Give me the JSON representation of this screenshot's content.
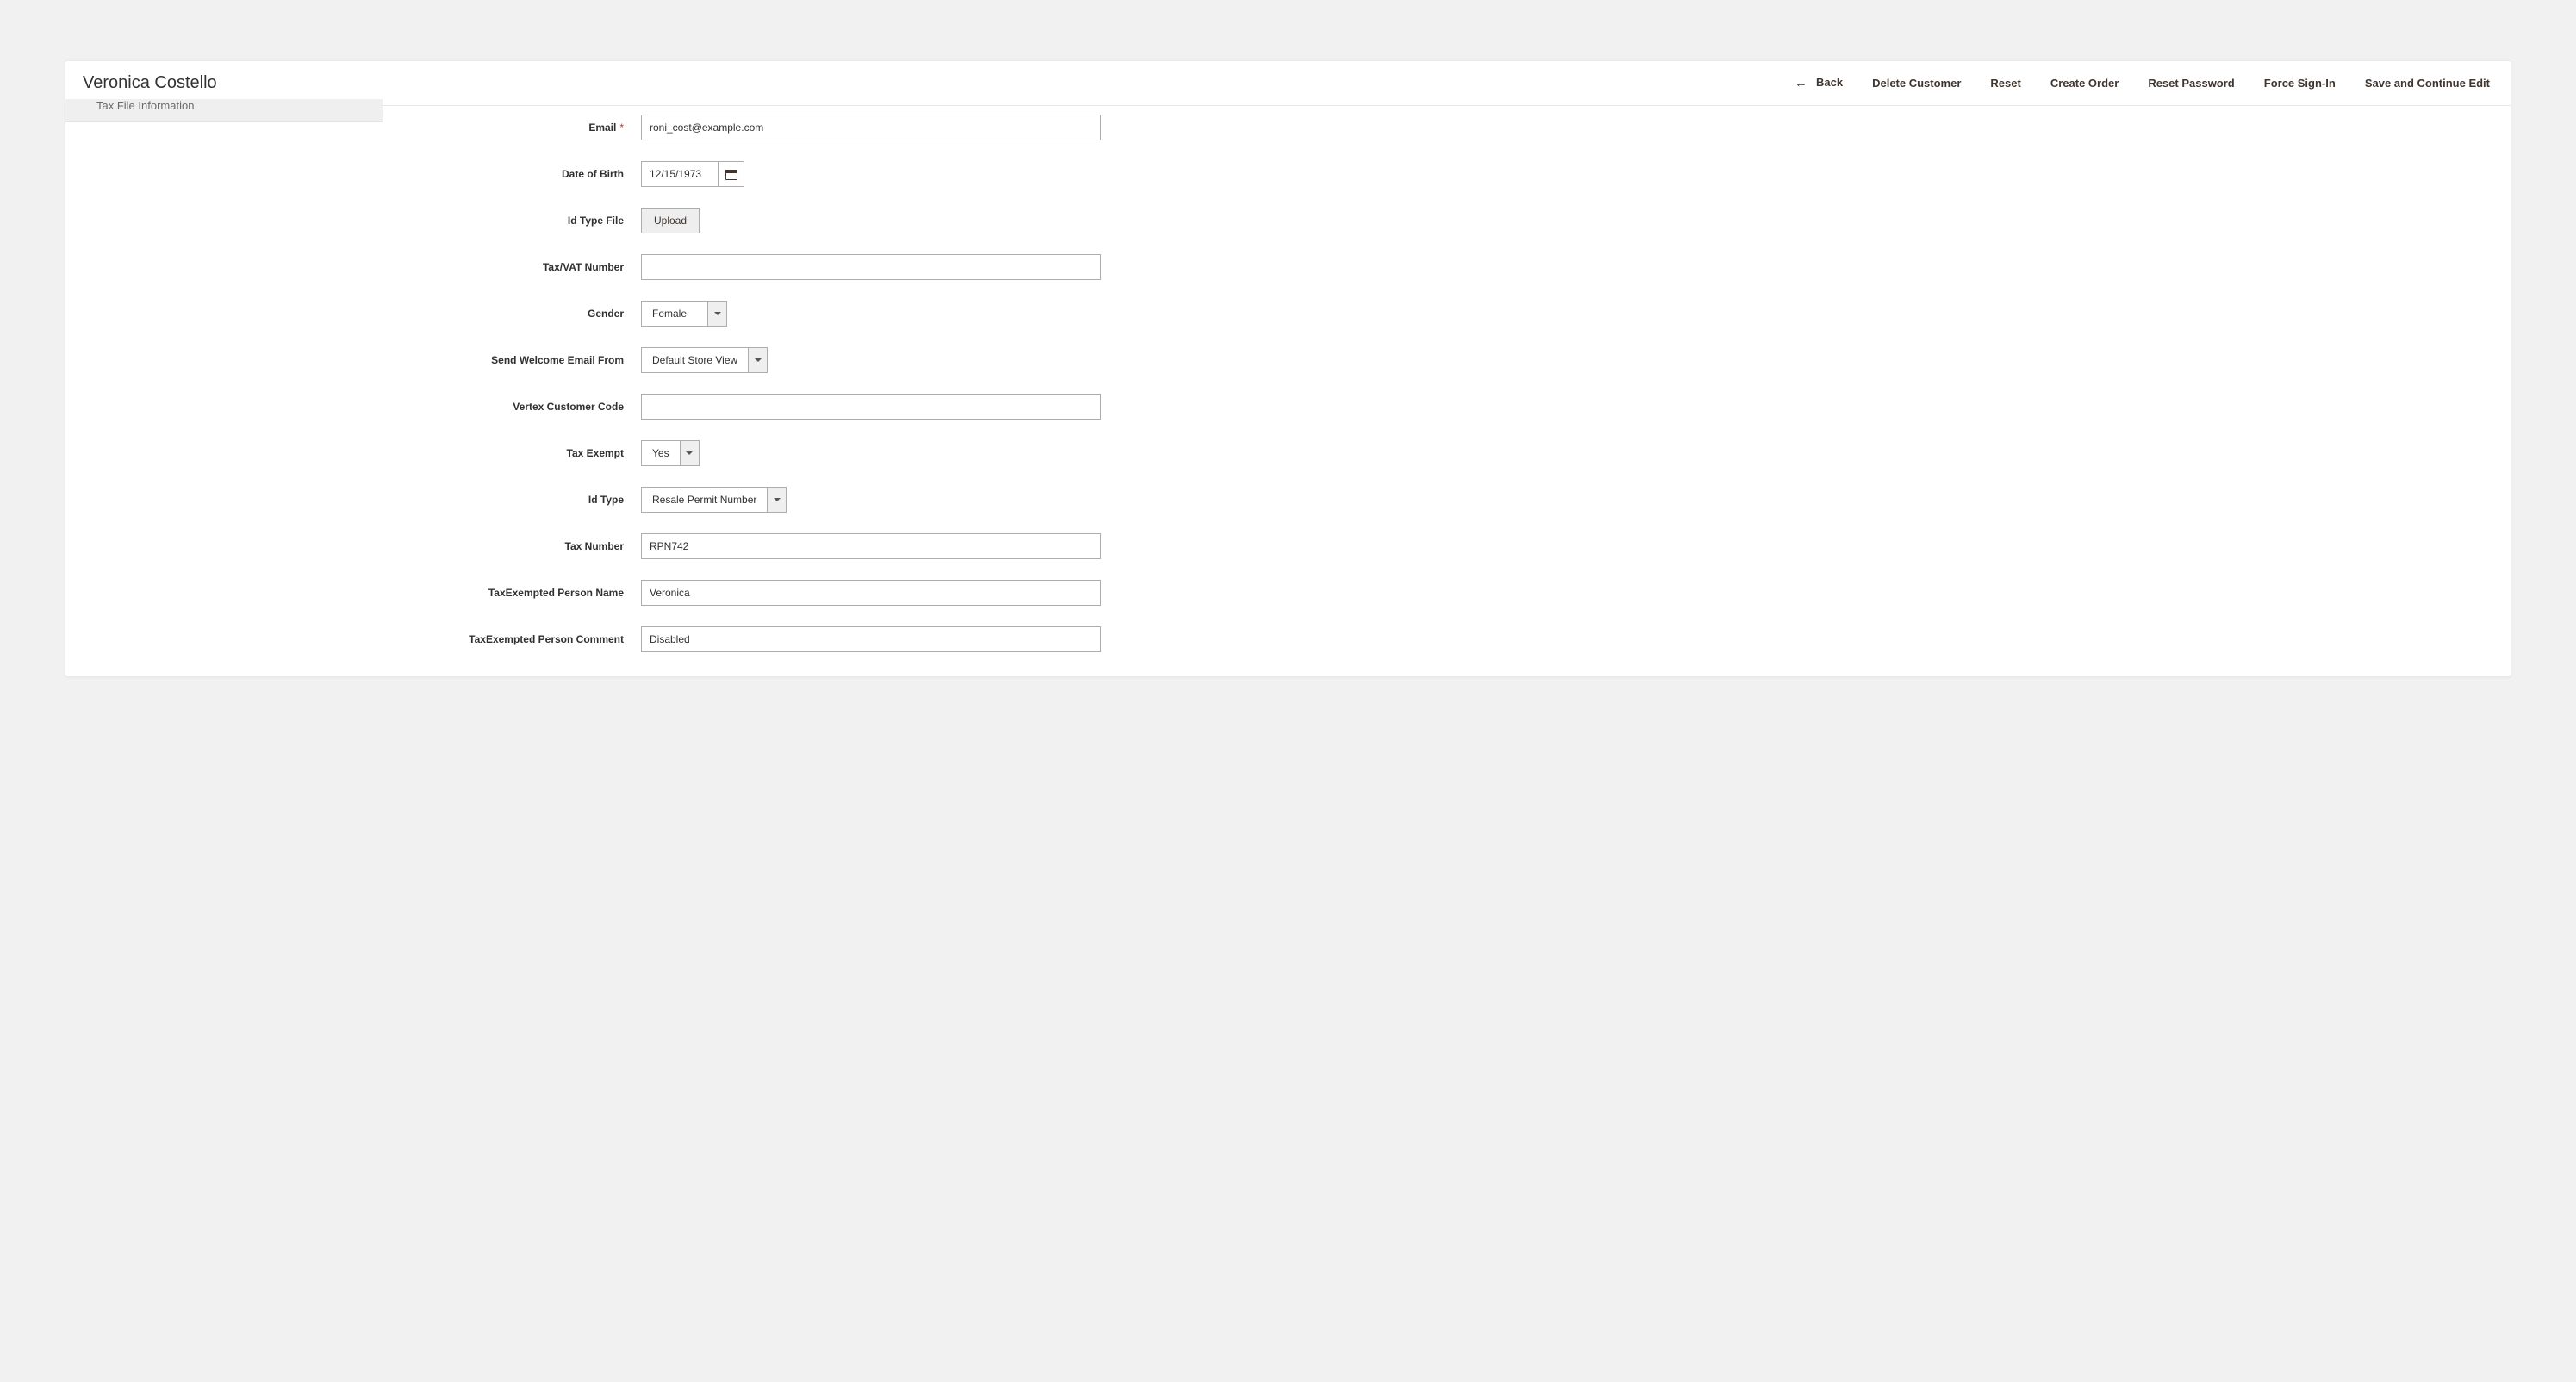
{
  "header": {
    "title": "Veronica Costello",
    "actions": {
      "back": "Back",
      "delete": "Delete Customer",
      "reset": "Reset",
      "create_order": "Create Order",
      "reset_password": "Reset Password",
      "force_signin": "Force Sign-In",
      "save_continue": "Save and Continue Edit"
    }
  },
  "sidebar": {
    "items": [
      {
        "label": "Tax File Information"
      }
    ]
  },
  "form": {
    "email": {
      "label": "Email",
      "required": true,
      "value": "roni_cost@example.com"
    },
    "dob": {
      "label": "Date of Birth",
      "value": "12/15/1973"
    },
    "id_type_file": {
      "label": "Id Type File",
      "button": "Upload"
    },
    "tax_vat": {
      "label": "Tax/VAT Number",
      "value": ""
    },
    "gender": {
      "label": "Gender",
      "value": "Female"
    },
    "welcome_email": {
      "label": "Send Welcome Email From",
      "value": "Default Store View"
    },
    "vertex": {
      "label": "Vertex Customer Code",
      "value": ""
    },
    "tax_exempt": {
      "label": "Tax Exempt",
      "value": "Yes"
    },
    "id_type": {
      "label": "Id Type",
      "value": "Resale Permit Number"
    },
    "tax_number": {
      "label": "Tax Number",
      "value": "RPN742"
    },
    "tax_exempt_name": {
      "label": "TaxExempted Person Name",
      "value": "Veronica"
    },
    "tax_exempt_comment": {
      "label": "TaxExempted Person Comment",
      "value": "Disabled"
    }
  }
}
